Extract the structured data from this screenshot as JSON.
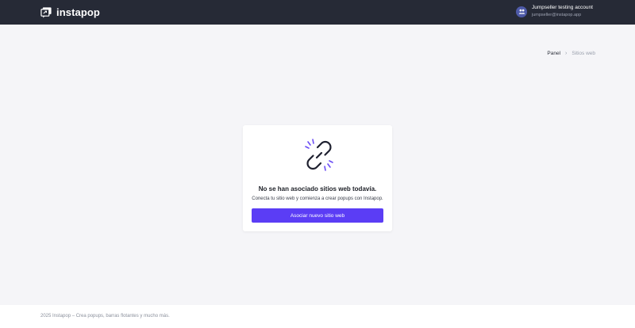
{
  "header": {
    "logo_text": "instapop",
    "account_name": "Jumpseller testing account",
    "account_email": "jumpseller@instapop.app"
  },
  "breadcrumb": {
    "home": "Panel",
    "separator": "›",
    "current": "Sitios web"
  },
  "empty_state": {
    "title": "No se han asociado sitios web todavía.",
    "description": "Conecta tu sitio web y comienza a crear popups con Instapop.",
    "button_label": "Asociar nuevo sitio web",
    "icon": "broken-link-icon"
  },
  "footer": {
    "text": "2025 Instapop – Crea popups, barras flotantes y mucho más."
  },
  "colors": {
    "topbar": "#262a36",
    "accent": "#5b3df5",
    "background": "#f5f5f8"
  }
}
